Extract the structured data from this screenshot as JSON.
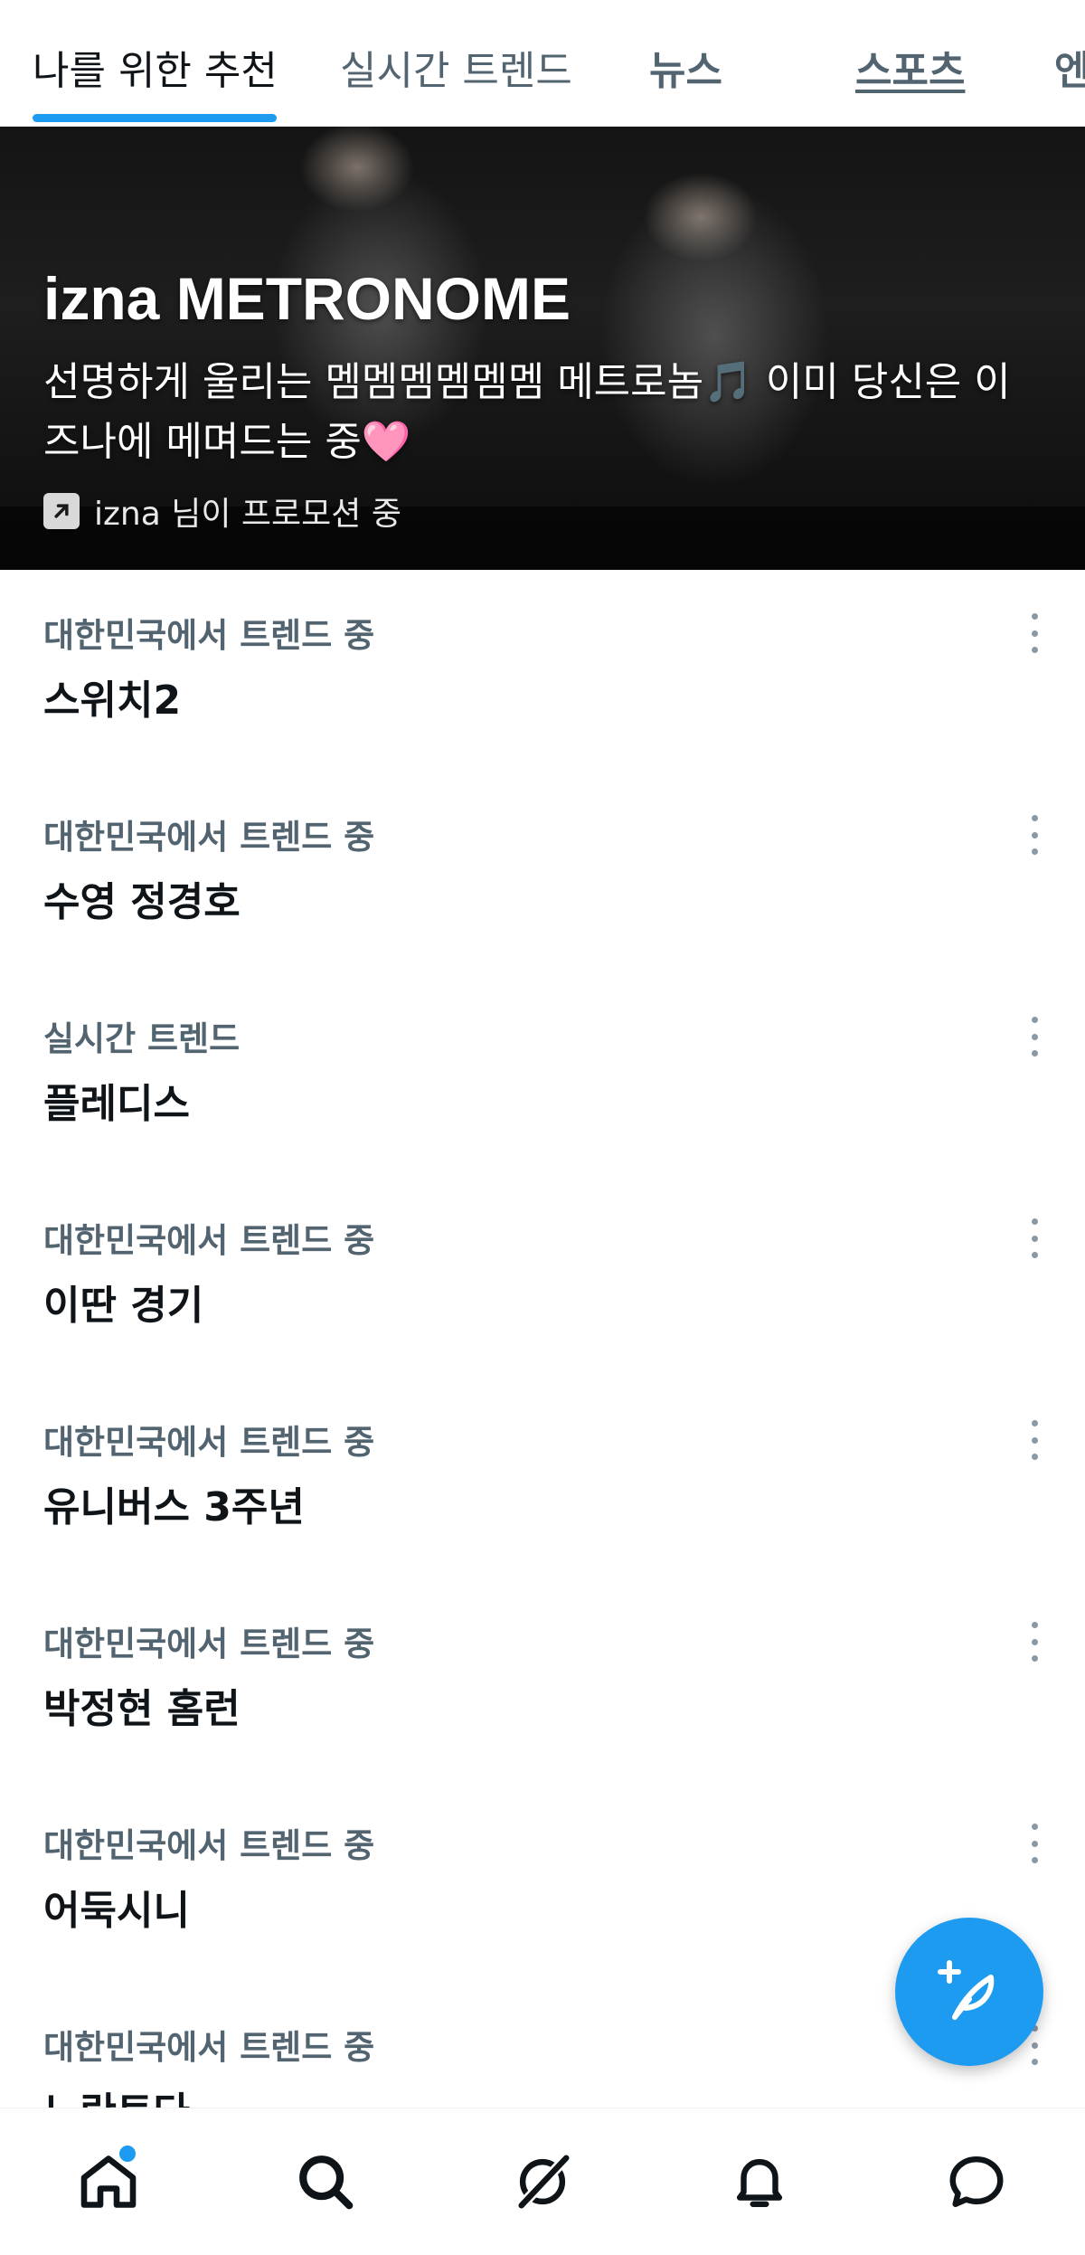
{
  "tabs": [
    {
      "label": "나를 위한 추천",
      "active": true
    },
    {
      "label": "실시간 트렌드",
      "active": false
    },
    {
      "label": "뉴스",
      "active": false
    },
    {
      "label": "스포츠",
      "active": false
    },
    {
      "label": "엔",
      "active": false
    }
  ],
  "promo": {
    "title": "izna METRONOME",
    "description": "선명하게 울리는 멤멤멤멤멤멤 메트로놈🎵 이미 당신은 이즈나에 메며드는 중🩷",
    "promoted_by": "izna 님이 프로모션 중",
    "promoted_icon": "promoted-arrow-icon"
  },
  "trends": [
    {
      "context": "대한민국에서 트렌드 중",
      "name": "스위치2"
    },
    {
      "context": "대한민국에서 트렌드 중",
      "name": "수영 정경호"
    },
    {
      "context": "실시간 트렌드",
      "name": "플레디스"
    },
    {
      "context": "대한민국에서 트렌드 중",
      "name": "이딴 경기"
    },
    {
      "context": "대한민국에서 트렌드 중",
      "name": "유니버스 3주년"
    },
    {
      "context": "대한민국에서 트렌드 중",
      "name": "박정현 홈런"
    },
    {
      "context": "대한민국에서 트렌드 중",
      "name": "어둑시니"
    },
    {
      "context": "대한민국에서 트렌드 중",
      "name": "노란토다"
    }
  ],
  "fab": {
    "icon": "compose-feather-plus-icon"
  },
  "bottom_nav": [
    {
      "icon": "home-icon",
      "notification": true
    },
    {
      "icon": "search-icon",
      "notification": false
    },
    {
      "icon": "grok-icon",
      "notification": false
    },
    {
      "icon": "bell-icon",
      "notification": false
    },
    {
      "icon": "chat-icon",
      "notification": false
    }
  ],
  "colors": {
    "accent": "#1d9bf0",
    "text_primary": "#0f1419",
    "text_secondary": "#536471"
  }
}
